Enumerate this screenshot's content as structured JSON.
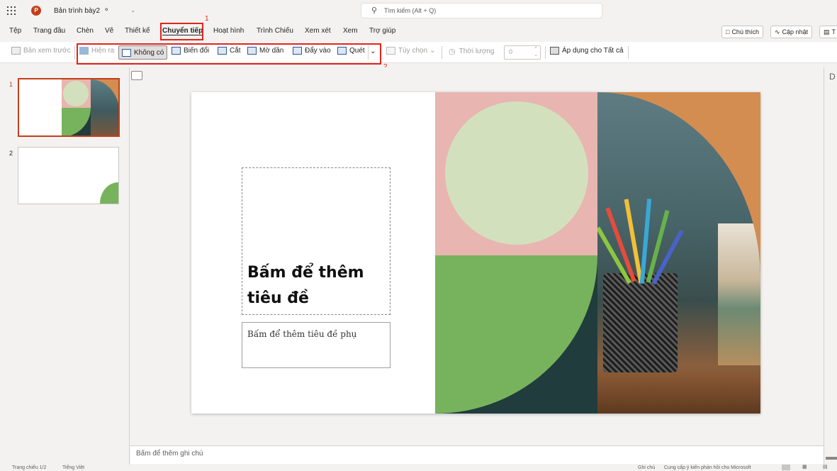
{
  "titlebar": {
    "doc_title": "Bản trình bày2",
    "search_placeholder": "Tìm kiếm (Alt + Q)"
  },
  "menu": {
    "items": [
      "Tệp",
      "Trang đầu",
      "Chèn",
      "Vẽ",
      "Thiết kế",
      "Chuyển tiếp",
      "Hoạt hình",
      "Trình Chiếu",
      "Xem xét",
      "Xem",
      "Trợ giúp"
    ],
    "active": "Chuyển tiếp",
    "comments": "Chú thích",
    "catchup": "Cập nhật",
    "present": "T"
  },
  "ribbon": {
    "preview": "Bản xem trước",
    "appear": "Hiện ra",
    "none": "Không có",
    "morph": "Biến đổi",
    "cut": "Cắt",
    "fade": "Mờ dần",
    "push": "Đẩy vào",
    "wipe": "Quét",
    "options": "Tùy chọn",
    "duration": "Thời lượng",
    "duration_value": "0",
    "apply_all": "Áp dụng cho Tất cả"
  },
  "annotations": {
    "first": "1",
    "second": "2"
  },
  "thumbnails": [
    {
      "number": "1"
    },
    {
      "number": "2"
    }
  ],
  "slide": {
    "title": "Bấm để thêm tiêu đề",
    "subtitle": "Bấm để thêm tiêu đề phụ"
  },
  "notes_placeholder": "Bấm để thêm ghi chú",
  "right_pane_letter": "D",
  "status": {
    "slide_count": "Trang chiếu 1/2",
    "language": "Tiếng Việt",
    "notes": "Ghi chú",
    "feedback": "Cung cấp ý kiến phản hồi cho Microsoft"
  },
  "colors": {
    "accent_red": "#e3241b",
    "pink": "#e8b5b1",
    "light_green": "#d3e0bd",
    "green": "#77b35c",
    "dark_teal": "#213c3c",
    "orange": "#d38d51",
    "ppt_red": "#c43e1c"
  }
}
